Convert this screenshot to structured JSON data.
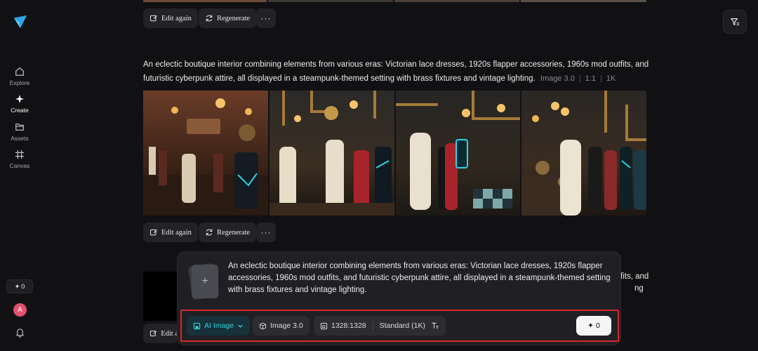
{
  "sidebar": {
    "items": [
      {
        "label": "Explore",
        "icon": "home-icon"
      },
      {
        "label": "Create",
        "icon": "sparkle-icon"
      },
      {
        "label": "Assets",
        "icon": "folder-icon"
      },
      {
        "label": "Canvas",
        "icon": "canvas-icon"
      }
    ],
    "credits": "0",
    "avatar_letter": "A"
  },
  "actions": {
    "edit_again": "Edit again",
    "regenerate": "Regenerate",
    "more": "···",
    "partial_edit": "Edit a"
  },
  "generation": {
    "prompt": "An eclectic boutique interior combining elements from various eras: Victorian lace dresses, 1920s flapper accessories, 1960s mod outfits, and futuristic cyberpunk attire, all displayed in a steampunk-themed setting with brass fixtures and vintage lighting.",
    "model": "Image 3.0",
    "ratio": "1:1",
    "resolution": "1K"
  },
  "peek": {
    "line1": "fits, and",
    "line2": "with brass fixtures and vintage lighting."
  },
  "composer": {
    "text": "An eclectic boutique interior combining elements from various eras: Victorian lace dresses, 1920s flapper accessories, 1960s mod outfits, and futuristic cyberpunk attire, all displayed in a steampunk-themed setting with brass fixtures and vintage lighting.",
    "type_label": "AI Image",
    "model_label": "Image 3.0",
    "size_label": "1328:1328",
    "quality_label": "Standard (1K)",
    "generate_cost": "0"
  },
  "colors": {
    "accent_cyan": "#37d0de",
    "highlight_red": "#d8282e",
    "background": "#111113"
  }
}
